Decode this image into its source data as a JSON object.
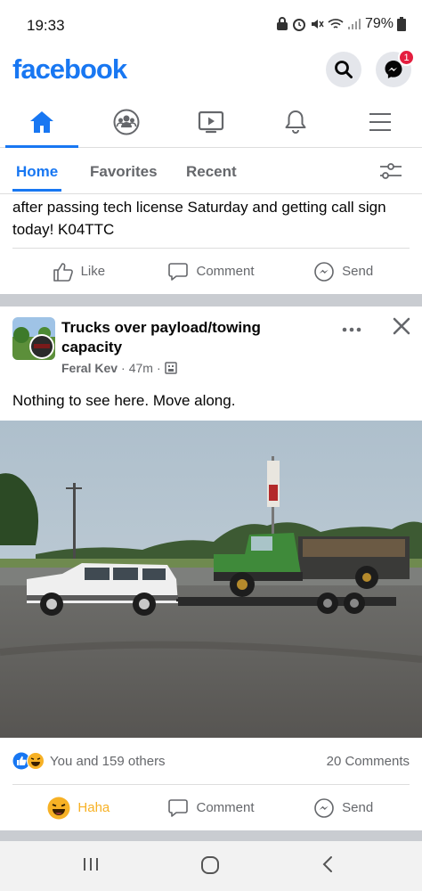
{
  "status": {
    "time": "19:33",
    "battery": "79%"
  },
  "header": {
    "brand": "facebook",
    "messenger_badge": "1"
  },
  "nav": {
    "items": [
      "home-icon",
      "groups-icon",
      "watch-icon",
      "notifications-icon",
      "menu-icon"
    ],
    "active": "home-icon"
  },
  "subtabs": {
    "home": "Home",
    "favorites": "Favorites",
    "recent": "Recent"
  },
  "prev_post": {
    "text": "after passing tech license Saturday and getting call sign today! K04TTC",
    "actions": {
      "like": "Like",
      "comment": "Comment",
      "send": "Send"
    }
  },
  "post": {
    "group": "Trucks over payload/towing capacity",
    "author": "Feral Kev",
    "time": "47m",
    "separator": "·",
    "text": "Nothing to see here. Move along.",
    "reactions_text": "You and 159 others",
    "comments_count": "20 Comments",
    "actions": {
      "reaction": "Haha",
      "comment": "Comment",
      "send": "Send"
    }
  },
  "colors": {
    "brand": "#1877f2",
    "haha": "#f7b125",
    "divider": "#c9ccd1"
  }
}
